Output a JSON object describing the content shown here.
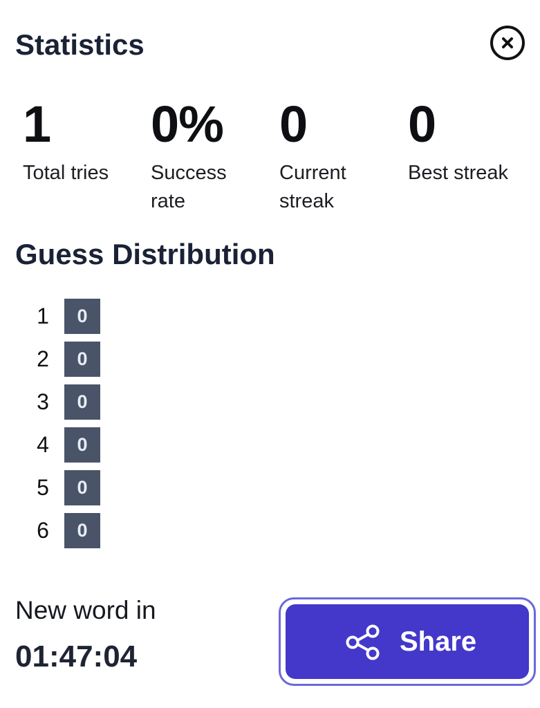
{
  "header": {
    "title": "Statistics",
    "close_icon": "close-circle-icon"
  },
  "stats": [
    {
      "value": "1",
      "label": "Total tries"
    },
    {
      "value": "0%",
      "label": "Success rate"
    },
    {
      "value": "0",
      "label": "Current streak"
    },
    {
      "value": "0",
      "label": "Best streak"
    }
  ],
  "distribution": {
    "title": "Guess Distribution",
    "rows": [
      {
        "guess": "1",
        "count": "0"
      },
      {
        "guess": "2",
        "count": "0"
      },
      {
        "guess": "3",
        "count": "0"
      },
      {
        "guess": "4",
        "count": "0"
      },
      {
        "guess": "5",
        "count": "0"
      },
      {
        "guess": "6",
        "count": "0"
      }
    ]
  },
  "countdown": {
    "label": "New word in",
    "time": "01:47:04"
  },
  "share": {
    "label": "Share",
    "icon": "share-icon"
  },
  "colors": {
    "accent": "#4338ca",
    "bar": "#4a5468",
    "title": "#1a2236"
  }
}
